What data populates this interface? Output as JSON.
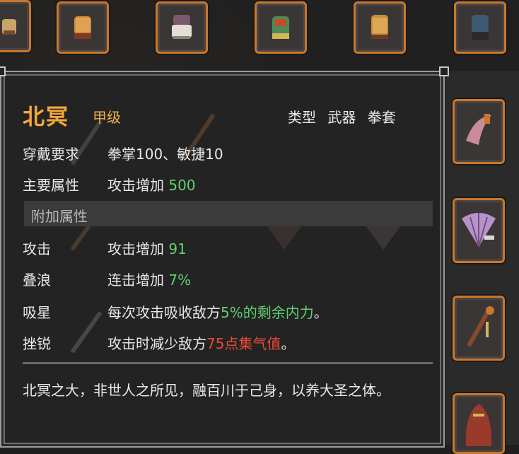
{
  "item": {
    "name": "北冥",
    "grade": "甲级",
    "type_label": "类型",
    "type_value": "武器 拳套"
  },
  "requirements": {
    "label": "穿戴要求",
    "value": "拳掌100、敏捷10"
  },
  "main_attr": {
    "label": "主要属性",
    "text": "攻击增加 ",
    "num": "500"
  },
  "extra_header": "附加属性",
  "extras": [
    {
      "label": "攻击",
      "text": "攻击增加 ",
      "num": "91",
      "suffix": "",
      "color": "#5fd16f"
    },
    {
      "label": "叠浪",
      "text": "连击增加 ",
      "num": "7%",
      "suffix": "",
      "color": "#5fd16f"
    },
    {
      "label": "吸星",
      "text": "每次攻击吸收敌方",
      "num": "5%的剩余内力",
      "suffix": "。",
      "color": "#5fd16f"
    },
    {
      "label": "挫锐",
      "text": "攻击时减少敌方",
      "num": "75点集气值",
      "suffix": "。",
      "color": "#e84a3a"
    }
  ],
  "description": "北冥之大，非世人之所见，融百川于己身，以养大圣之体。",
  "icons": {
    "top_row": [
      "gauntlet-partial-icon",
      "gauntlet-gold-icon",
      "gauntlet-purple-icon",
      "gauntlet-green-icon",
      "gauntlet-tan-icon",
      "gauntlet-blue-icon"
    ],
    "right_col": [
      "crescent-blade-icon",
      "fan-icon",
      "staff-icon",
      "hood-icon"
    ]
  },
  "colors": {
    "accent": "#c9772a",
    "title": "#f3a83a",
    "positive": "#5fd16f",
    "negative": "#e84a3a"
  }
}
